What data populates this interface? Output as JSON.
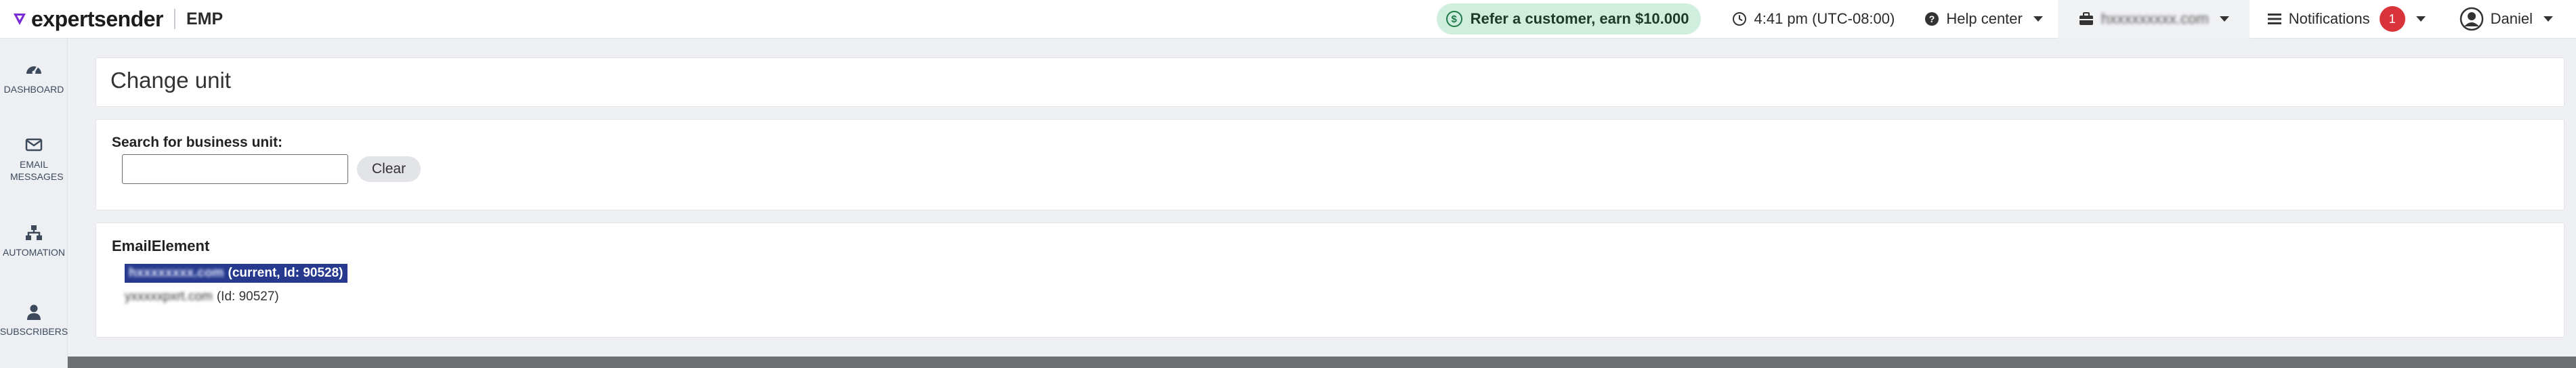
{
  "brand": {
    "name": "expertsender",
    "product": "EMP",
    "accent": "#7a2bd4"
  },
  "header": {
    "promo_label": "Refer a customer, earn $10.000",
    "time": "4:41 pm (UTC-08:00)",
    "help_label": "Help center",
    "account_domain": "hxxxxxxxxx.com",
    "notifications_label": "Notifications",
    "notifications_count": "1",
    "user_name": "Daniel"
  },
  "sidebar": {
    "items": [
      {
        "label": "DASHBOARD",
        "icon": "dashboard-gauge-icon"
      },
      {
        "label": "EMAIL MESSAGES",
        "icon": "envelope-icon"
      },
      {
        "label": "AUTOMATION",
        "icon": "sitemap-icon"
      },
      {
        "label": "SUBSCRIBERS",
        "icon": "user-icon"
      }
    ]
  },
  "page": {
    "title": "Change unit"
  },
  "search": {
    "label": "Search for business unit:",
    "value": "",
    "clear_label": "Clear"
  },
  "units": {
    "group_name": "EmailElement",
    "current": {
      "domain": "hxxxxxxxx.com",
      "suffix": "(current, Id: 90528)"
    },
    "other": {
      "domain": "yxxxxxpxrt.com",
      "suffix": "(Id: 90527)"
    }
  },
  "colors": {
    "promo_bg": "#cfeedd",
    "badge": "#d9343b",
    "selection": "#26398e",
    "link": "#3d66b8"
  }
}
